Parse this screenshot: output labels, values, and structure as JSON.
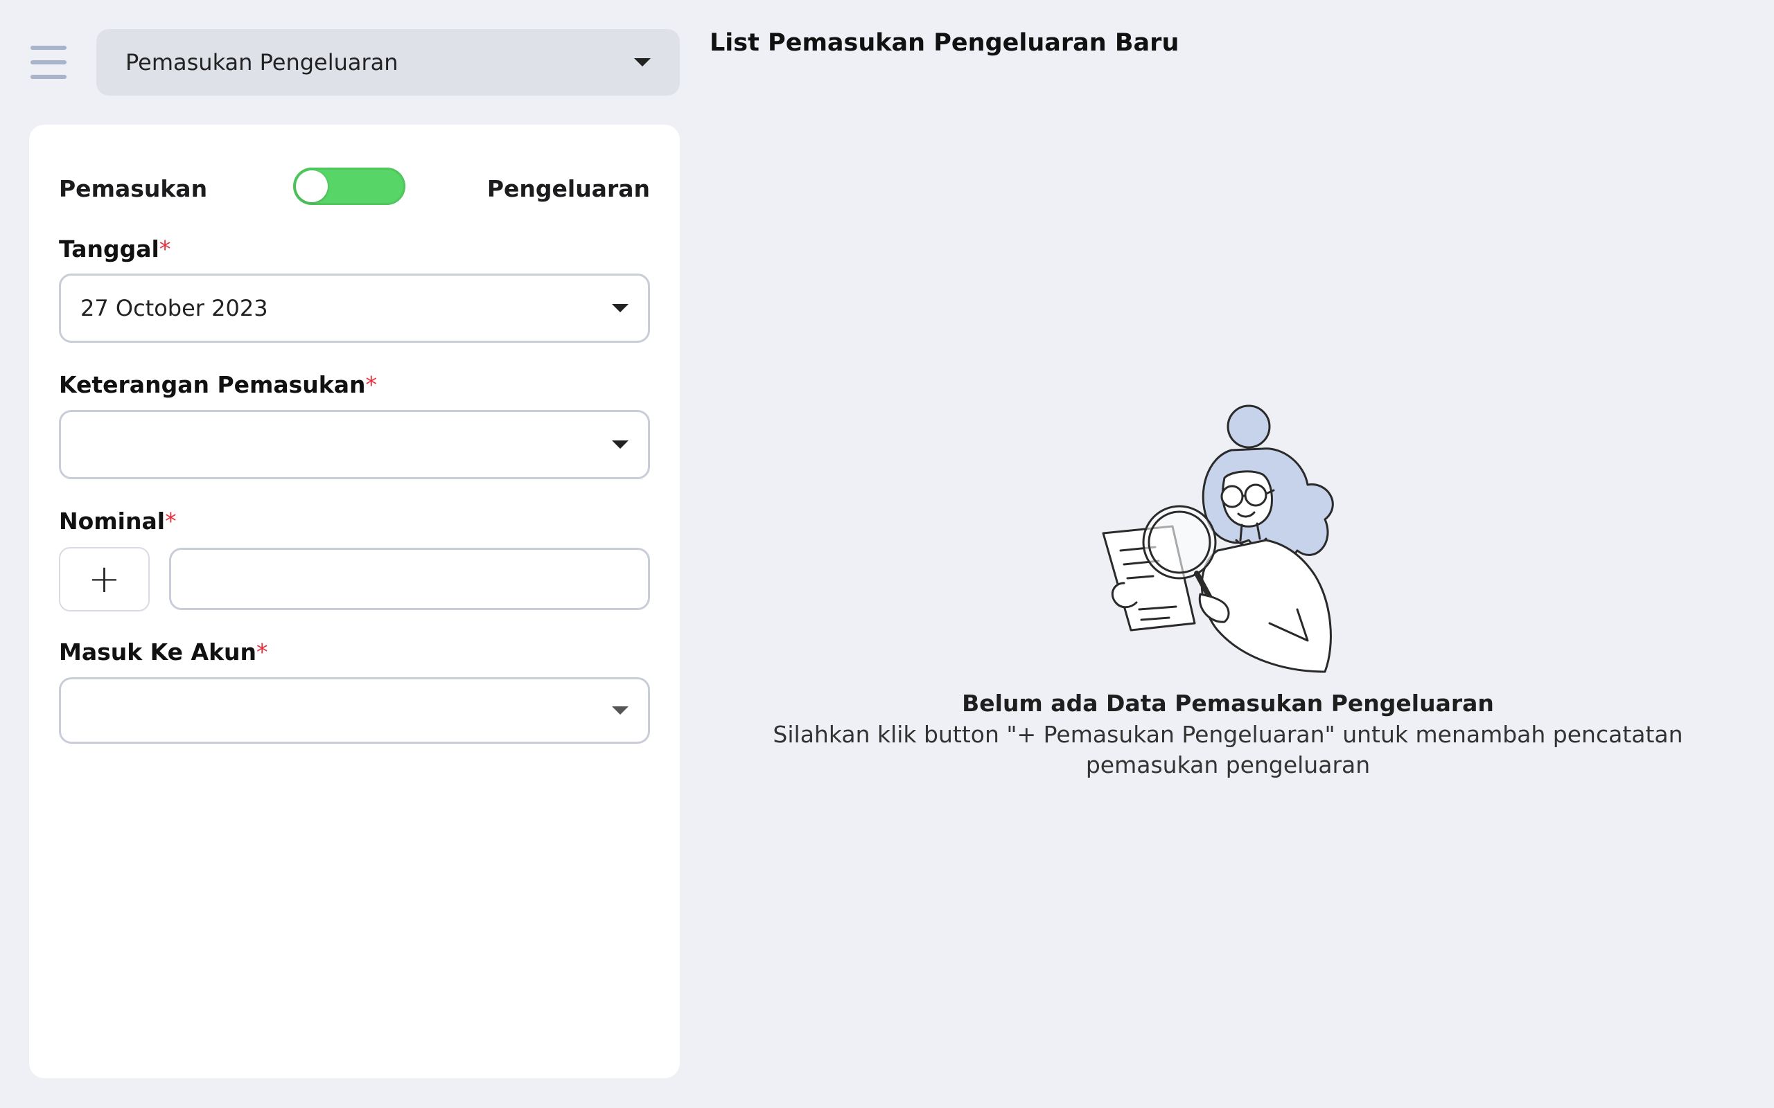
{
  "header": {
    "module_select": "Pemasukan Pengeluaran",
    "page_title": "List Pemasukan Pengeluaran Baru"
  },
  "form": {
    "toggle": {
      "left_label": "Pemasukan",
      "right_label": "Pengeluaran",
      "on": true
    },
    "required_mark": "*",
    "tanggal": {
      "label": "Tanggal",
      "value": "27 October 2023"
    },
    "keterangan": {
      "label": "Keterangan Pemasukan",
      "value": ""
    },
    "nominal": {
      "label": "Nominal",
      "value": "",
      "sign_button": "+"
    },
    "akun": {
      "label": "Masuk Ke Akun",
      "value": ""
    }
  },
  "empty_state": {
    "title": "Belum ada Data Pemasukan Pengeluaran",
    "description": "Silahkan klik button \"+ Pemasukan Pengeluaran\" untuk menambah pencatatan pemasukan pengeluaran"
  },
  "colors": {
    "background": "#eef0f5",
    "toggle_on": "#57d567",
    "required": "#e8313f",
    "illustration_accent": "#c7d3ea"
  }
}
